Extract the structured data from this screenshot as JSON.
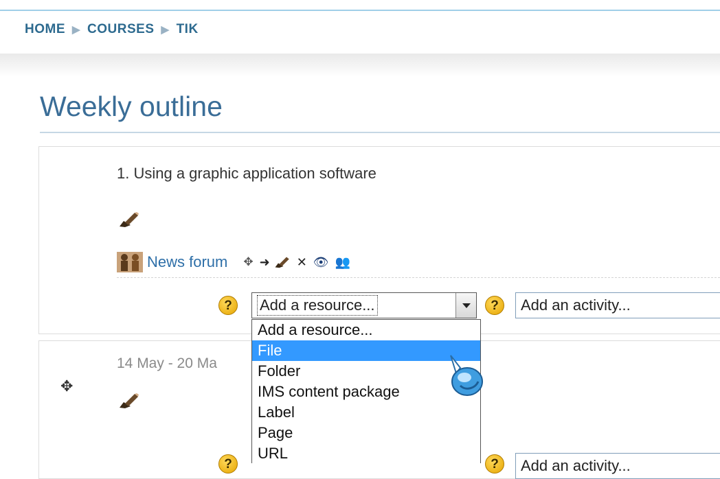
{
  "breadcrumb": {
    "items": [
      "HOME",
      "COURSES",
      "TIK"
    ],
    "separator": "▶"
  },
  "page": {
    "title": "Weekly outline"
  },
  "section1": {
    "title": "1. Using a graphic application software",
    "news_forum_label": "News forum",
    "tools": {
      "move": "✥",
      "indent": "➜",
      "delete": "✕",
      "hide": "👁",
      "group": "👥"
    },
    "add_resource": {
      "value": "Add a resource...",
      "options": [
        "Add a resource...",
        "File",
        "Folder",
        "IMS content package",
        "Label",
        "Page",
        "URL"
      ],
      "highlighted": "File"
    },
    "add_activity_value": "Add an activity...",
    "help_glyph": "?"
  },
  "section2": {
    "date_title": "14 May - 20 Ma",
    "move_glyph": "✥",
    "add_activity_value": "Add an activity..."
  },
  "colors": {
    "link": "#2e6fa8",
    "title": "#3a6d97",
    "highlight": "#3399ff",
    "help_icon": "#f2b600"
  }
}
